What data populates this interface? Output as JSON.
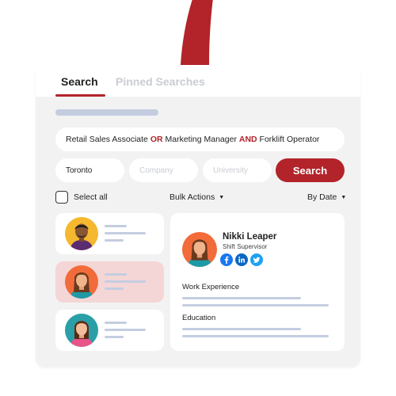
{
  "colors": {
    "accent": "#b3232a",
    "card_bg": "#f2f2f3",
    "placeholder": "#c4cde0",
    "selected_row": "#f4d6d6"
  },
  "tabs": [
    {
      "label": "Search",
      "active": true
    },
    {
      "label": "Pinned Searches",
      "active": false
    }
  ],
  "query": {
    "parts": [
      "Retail Sales Associate",
      "OR",
      "Marketing Manager",
      "AND",
      "Forklift Operator"
    ]
  },
  "filters": {
    "location": "Toronto",
    "company_placeholder": "Company",
    "university_placeholder": "University",
    "search_button": "Search"
  },
  "toolbar": {
    "select_all": "Select all",
    "bulk_actions": "Bulk Actions",
    "sort": "By Date",
    "caret": "▼"
  },
  "candidates": [
    {
      "avatar": "man-avatar-icon",
      "selected": false
    },
    {
      "avatar": "woman-avatar-icon",
      "selected": true
    },
    {
      "avatar": "woman-teal-avatar-icon",
      "selected": false
    }
  ],
  "profile": {
    "name": "Nikki Leaper",
    "title": "Shift Supervisor",
    "socials": [
      "facebook-icon",
      "linkedin-icon",
      "twitter-icon"
    ],
    "sections": [
      "Work Experience",
      "Education"
    ]
  }
}
